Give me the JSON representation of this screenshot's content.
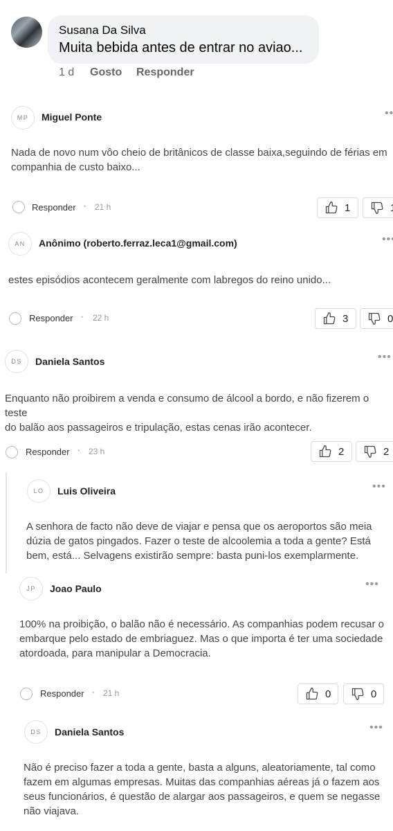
{
  "fb_comment": {
    "author": "Susana Da Silva",
    "text": "Muita bebida antes de entrar no aviao...",
    "time": "1 d",
    "like_label": "Gosto",
    "reply_label": "Responder"
  },
  "comments": [
    {
      "initials": "MP",
      "author": "Miguel Ponte",
      "lines": [
        "Nada de novo num vôo cheio de britânicos de classe baixa,seguindo de férias em",
        "companhia de custo baixo..."
      ],
      "reply_label": "Responder",
      "time": "21 h",
      "upvotes": "1",
      "downvotes": "1"
    },
    {
      "initials": "AN",
      "author": "Anônimo (roberto.ferraz.leca1@gmail.com)",
      "lines": [
        "estes episódios acontecem geralmente com labregos do reino unido..."
      ],
      "reply_label": "Responder",
      "time": "22 h",
      "upvotes": "3",
      "downvotes": "0"
    },
    {
      "initials": "DS",
      "author": "Daniela Santos",
      "lines": [
        "Enquanto não proibirem a venda e consumo de álcool a bordo, e não fizerem o teste",
        "do balão aos passageiros e tripulação, estas cenas irão acontecer."
      ],
      "reply_label": "Responder",
      "time": "23 h",
      "upvotes": "2",
      "downvotes": "2"
    },
    {
      "initials": "LO",
      "author": "Luis Oliveira",
      "lines": [
        "A senhora de facto não deve de viajar e pensa que os aeroportos são meia",
        "dúzia de gatos pingados. Fazer o teste de alcoolemia a toda a gente? Está",
        "bem, está... Selvagens existirão sempre: basta puni-los exemplarmente."
      ]
    },
    {
      "initials": "JP",
      "author": "Joao Paulo",
      "lines": [
        "100% na proibição, o balão não é necessário. As companhias podem recusar o",
        "embarque pelo estado de embriaguez. Mas o que importa é ter uma sociedade",
        "atordoada, para manipular a Democracia."
      ],
      "reply_label": "Responder",
      "time": "21 h",
      "upvotes": "0",
      "downvotes": "0"
    },
    {
      "initials": "DS",
      "author": "Daniela Santos",
      "lines": [
        "Não é preciso fazer a toda a gente, basta a alguns, aleatoriamente, tal como",
        "fazem em algumas empresas. Muitas das companhias aéreas já o fazem aos",
        "seus funcionários, é questão de alargar aos passageiros, e quem se negasse",
        "não viajava."
      ]
    }
  ],
  "icons": {
    "upvote": "thumbs-up-icon",
    "downvote": "thumbs-down-icon",
    "more": "more-dots-icon",
    "reply": "reply-circle-icon"
  }
}
